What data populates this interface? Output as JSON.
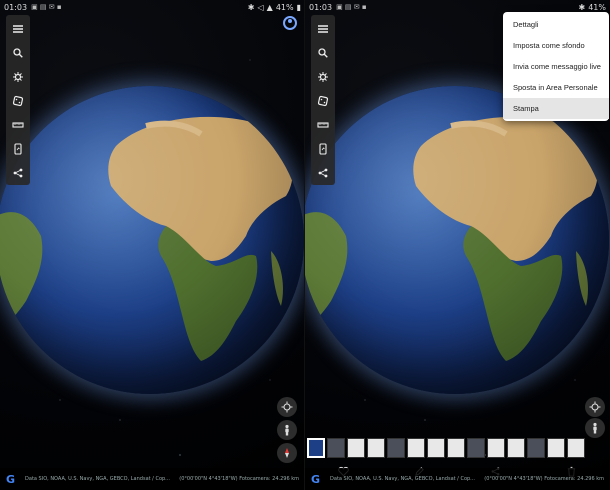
{
  "status_left": {
    "time": "01:03",
    "battery": "41%"
  },
  "status_right": {
    "time": "01:03",
    "battery": "41%"
  },
  "toolbar_icons": [
    "menu-icon",
    "search-icon",
    "voyager-icon",
    "dice-icon",
    "ruler-icon",
    "tablet-icon",
    "share-icon"
  ],
  "attribution": "Data SIO, NOAA, U.S. Navy, NGA, GEBCO, Landsat / Cop...",
  "camera_info": "(0°00'00\"N 4°43'18\"W) Fotocamera: 24.296 km",
  "google_logo": "G",
  "menu": {
    "items": [
      "Dettagli",
      "Imposta come sfondo",
      "Invia come messaggio live",
      "Sposta in Area Personale",
      "Stampa"
    ],
    "highlighted_index": 4
  },
  "colors": {
    "accent": "#7aa7ff",
    "ocean": "#1d3f86",
    "land_desert": "#c9a46a",
    "land_green": "#4f6f2e"
  }
}
